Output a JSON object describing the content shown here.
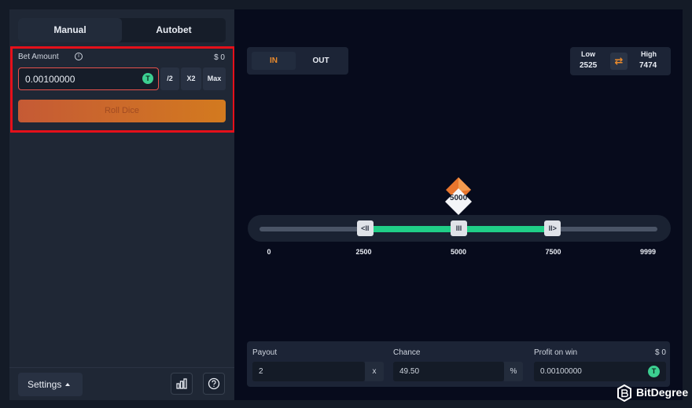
{
  "left": {
    "tabs": [
      {
        "label": "Manual"
      },
      {
        "label": "Autobet"
      }
    ],
    "bet": {
      "label": "Bet Amount",
      "info_icon": "i",
      "usd": "$ 0",
      "value": "0.00100000",
      "currency_icon": "T",
      "half": "/2",
      "double": "X2",
      "max": "Max"
    },
    "roll_label": "Roll Dice",
    "settings_label": "Settings"
  },
  "mode": {
    "in": "IN",
    "out": "OUT",
    "active": "IN"
  },
  "range": {
    "low_label": "Low",
    "low_value": "2525",
    "high_label": "High",
    "high_value": "7474",
    "swap_icon": "⇄"
  },
  "slider": {
    "min": 0,
    "max": 9999,
    "marker_value": "5000",
    "handle_low": 2525,
    "handle_mid": 5000,
    "handle_high": 7474,
    "handle_low_glyph": "<II",
    "handle_mid_glyph": "III",
    "handle_high_glyph": "II>",
    "ticks": [
      "0",
      "2500",
      "5000",
      "7500",
      "9999"
    ]
  },
  "bottom": {
    "payout_label": "Payout",
    "payout_value": "2",
    "payout_suffix": "x",
    "chance_label": "Chance",
    "chance_value": "49.50",
    "chance_suffix": "%",
    "profit_label": "Profit on win",
    "profit_usd": "$ 0",
    "profit_value": "0.00100000",
    "profit_icon": "T"
  },
  "brand": {
    "name": "BitDegree"
  },
  "colors": {
    "accent": "#eb8b2c",
    "green": "#20cf87",
    "highlight": "#e5101a"
  }
}
